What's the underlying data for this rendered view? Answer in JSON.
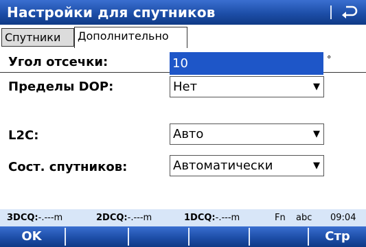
{
  "header": {
    "title": "Настройки для спутников",
    "back_icon": "back-arrow-icon"
  },
  "tabs": [
    {
      "label": "Спутники",
      "active": false
    },
    {
      "label": "Дополнительно",
      "active": true
    }
  ],
  "form": {
    "cutoff": {
      "label": "Угол отсечки:",
      "value": "10",
      "unit": "°"
    },
    "dop": {
      "label": "Пределы DOP:",
      "value": "Нет"
    },
    "l2c": {
      "label": "L2C:",
      "value": "Авто"
    },
    "sat_state": {
      "label": "Сост. спутников:",
      "value": "Автоматически"
    }
  },
  "status_bar": {
    "q3_label": "3DCQ:",
    "q3_value": "-.---m",
    "q2_label": "2DCQ:",
    "q2_value": "-.---m",
    "q1_label": "1DCQ:",
    "q1_value": "-.---m",
    "fn": "Fn",
    "input_mode": "abc",
    "time": "09:04"
  },
  "softkeys": {
    "ok": "OK",
    "page": "Стр"
  }
}
